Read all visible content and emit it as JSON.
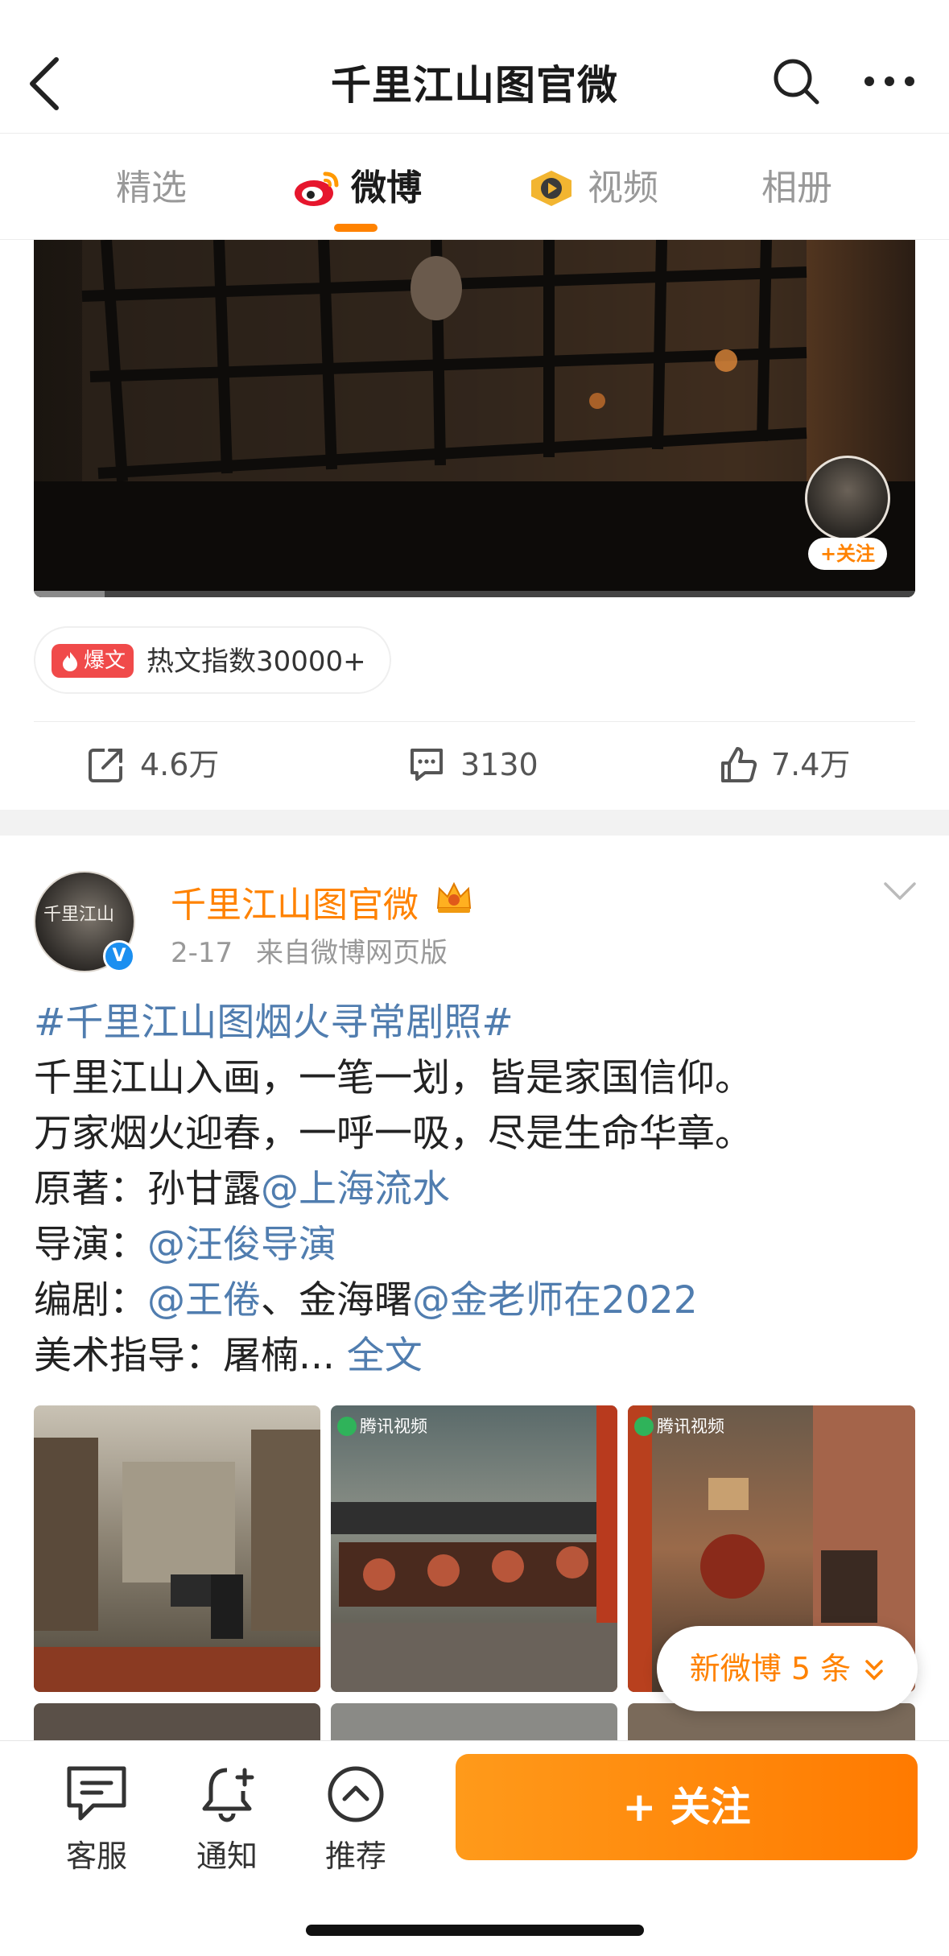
{
  "header": {
    "title": "千里江山图官微",
    "back_icon": "chevron-left-icon",
    "search_icon": "search-icon",
    "more_icon": "more-dots-icon"
  },
  "tabs": [
    {
      "label": "精选",
      "active": false
    },
    {
      "label": "微博",
      "active": true,
      "icon": "weibo-logo-icon"
    },
    {
      "label": "视频",
      "active": false,
      "icon": "video-play-icon"
    },
    {
      "label": "相册",
      "active": false
    }
  ],
  "video": {
    "follow_label": "+关注",
    "avatar_icon": "author-avatar",
    "progress_fraction": 0.08
  },
  "hot_badge": {
    "tag": "爆文",
    "text": "热文指数30000+"
  },
  "actions": {
    "repost": "4.6万",
    "comments": "3130",
    "likes": "7.4万"
  },
  "post": {
    "author": "千里江山图官微",
    "date": "2-17",
    "source": "来自微博网页版",
    "verified_icon": "verified-badge-icon",
    "crown_icon": "vip-crown-icon",
    "hashtag": "#千里江山图烟火寻常剧照#",
    "line1": "千里江山入画，一笔一划，皆是家国信仰。",
    "line2": "万家烟火迎春，一呼一吸，尽是生命华章。",
    "line3_label": "原著：孙甘露",
    "line3_link": "@上海流水",
    "line4_label": "导演：",
    "line4_link": "@汪俊导演",
    "line5_label": "编剧：",
    "line5_link1": "@王倦",
    "line5_mid": "、金海曙",
    "line5_link2": "@金老师在2022",
    "line6_label": "美术指导：屠楠...",
    "line6_link": "全文",
    "image_watermark": "腾讯视频",
    "new_posts": "新微博 5 条"
  },
  "bottom_bar": {
    "service": "客服",
    "notify": "通知",
    "recommend": "推荐",
    "follow": "+ 关注"
  },
  "colors": {
    "accent": "#ff8200",
    "link": "#507daf",
    "verified": "#1b8ff0",
    "hot_red": "#f04a4a"
  }
}
